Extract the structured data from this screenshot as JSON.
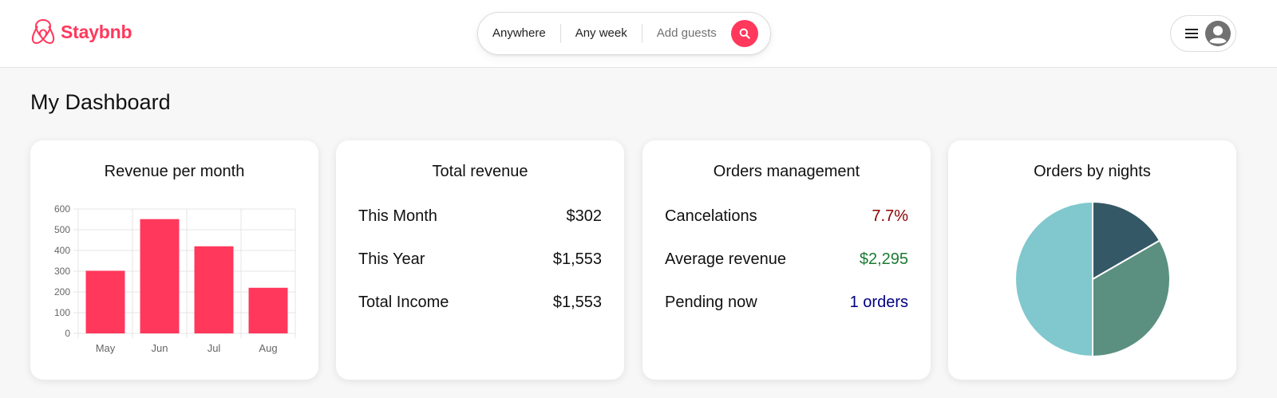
{
  "brand": {
    "name": "Staybnb",
    "color": "#ff385c"
  },
  "search": {
    "where": "Anywhere",
    "when": "Any week",
    "guests": "Add guests"
  },
  "page": {
    "title": "My Dashboard"
  },
  "cards": {
    "revenue_chart": {
      "title": "Revenue per month"
    },
    "total_revenue": {
      "title": "Total revenue",
      "rows": [
        {
          "label": "This Month",
          "value": "$302"
        },
        {
          "label": "This Year",
          "value": "$1,553"
        },
        {
          "label": "Total Income",
          "value": "$1,553"
        }
      ]
    },
    "orders": {
      "title": "Orders management",
      "rows": [
        {
          "label": "Cancelations",
          "value": "7.7%",
          "color": "#8b0000"
        },
        {
          "label": "Average revenue",
          "value": "$2,295",
          "color": "#1c7a33"
        },
        {
          "label": "Pending now",
          "value": "1 orders",
          "color": "#000080"
        }
      ]
    },
    "nights_chart": {
      "title": "Orders by nights"
    }
  },
  "chart_data": [
    {
      "type": "bar",
      "title": "Revenue per month",
      "categories": [
        "May",
        "Jun",
        "Jul",
        "Aug"
      ],
      "values": [
        302,
        551,
        420,
        220
      ],
      "ylim": [
        0,
        600
      ],
      "yticks": [
        0,
        100,
        200,
        300,
        400,
        500,
        600
      ],
      "bar_color": "#ff385c",
      "grid": true
    },
    {
      "type": "pie",
      "title": "Orders by nights",
      "values": [
        1,
        2,
        3
      ],
      "colors": [
        "#355866",
        "#5b9080",
        "#80c8cd"
      ]
    }
  ]
}
